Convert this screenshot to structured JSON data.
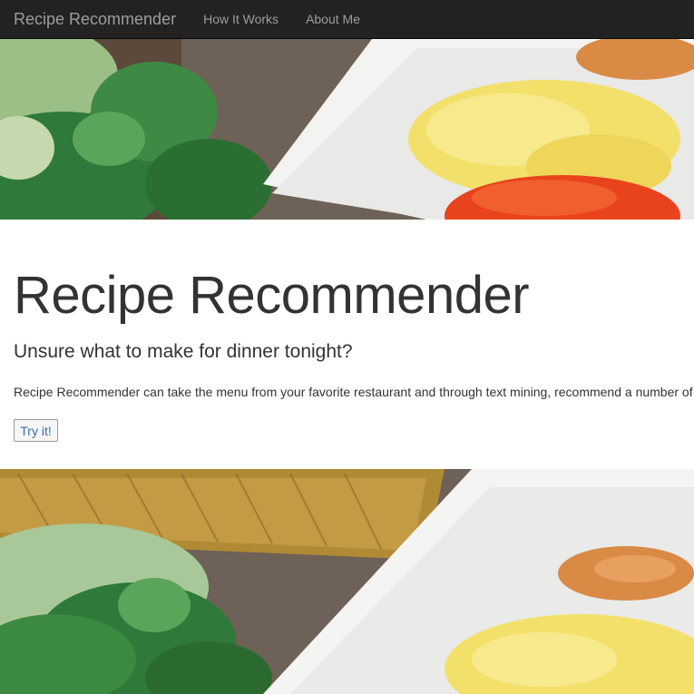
{
  "navbar": {
    "brand": "Recipe Recommender",
    "links": [
      "How It Works",
      "About Me"
    ]
  },
  "hero": {
    "title": "Recipe Recommender",
    "subtitle": "Unsure what to make for dinner tonight?",
    "description": "Recipe Recommender can take the menu from your favorite restaurant and through text mining, recommend a number of",
    "button_label": "Try it!"
  },
  "colors": {
    "navbar_bg": "#222222",
    "nav_text": "#9d9d9d",
    "button_text": "#3a6ea5"
  }
}
